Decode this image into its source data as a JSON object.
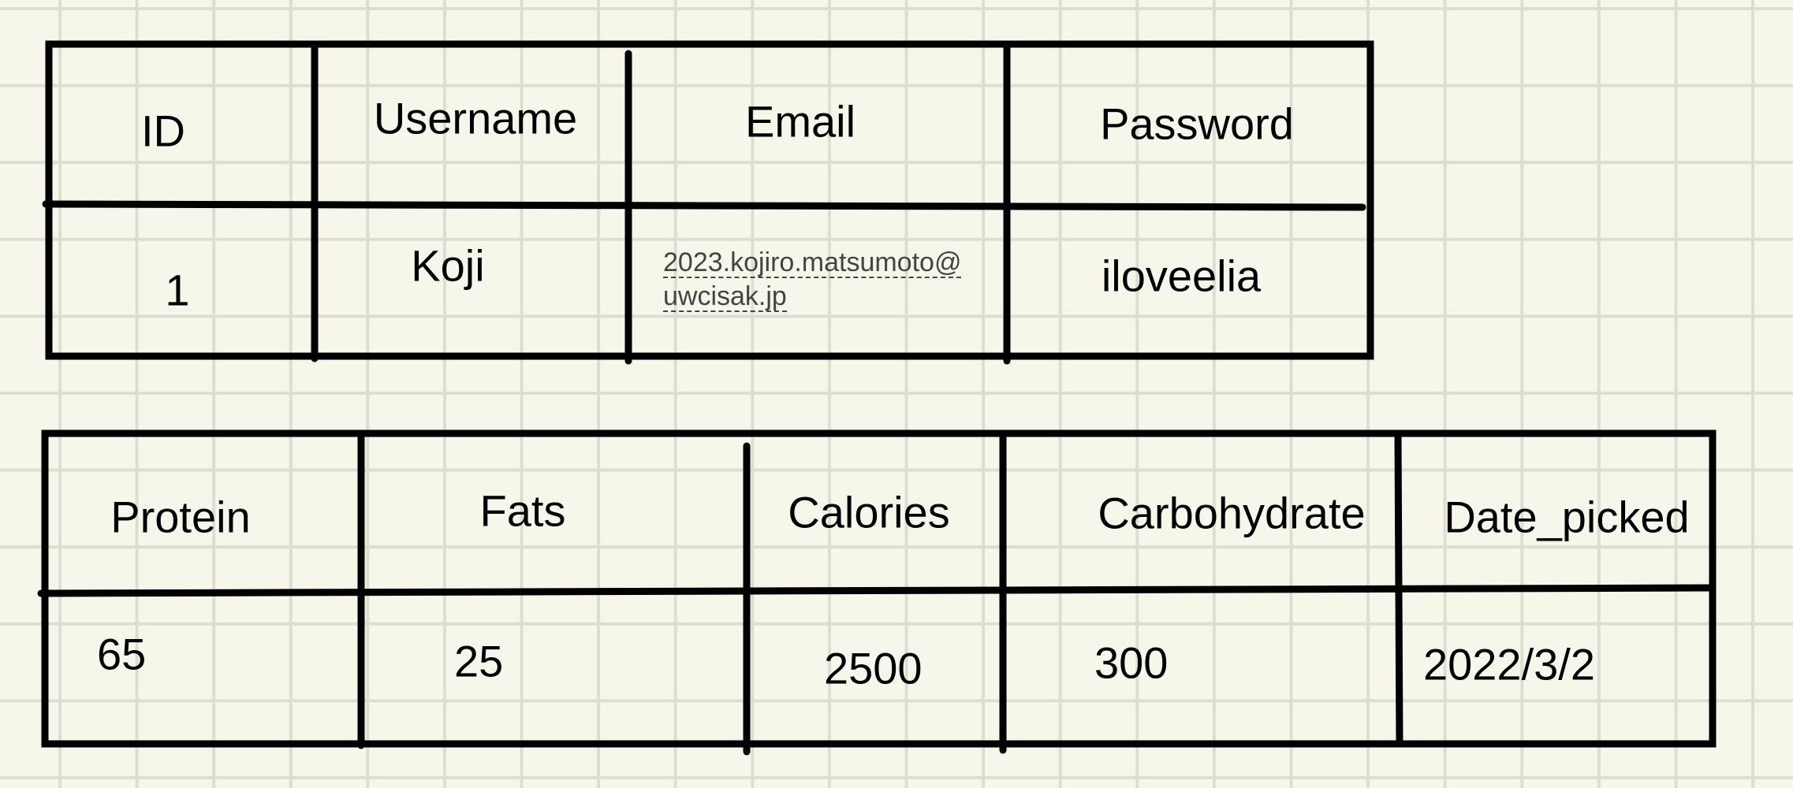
{
  "users_table": {
    "headers": [
      "ID",
      "Username",
      "Email",
      "Password"
    ],
    "row": {
      "id": "1",
      "username": "Koji",
      "email_line1": "2023.kojiro.matsumoto@",
      "email_line2": "uwcisak.jp",
      "password": "iloveelia"
    }
  },
  "nutrition_table": {
    "headers": [
      "Protein",
      "Fats",
      "Calories",
      "Carbohydrate",
      "Date_picked"
    ],
    "row": [
      "65",
      "25",
      "2500",
      "300",
      "2022/3/2"
    ]
  },
  "colors": {
    "paper": "#f7f6ea",
    "grid": "#dcdfd0",
    "ink": "#000000",
    "email_text": "#444444"
  }
}
